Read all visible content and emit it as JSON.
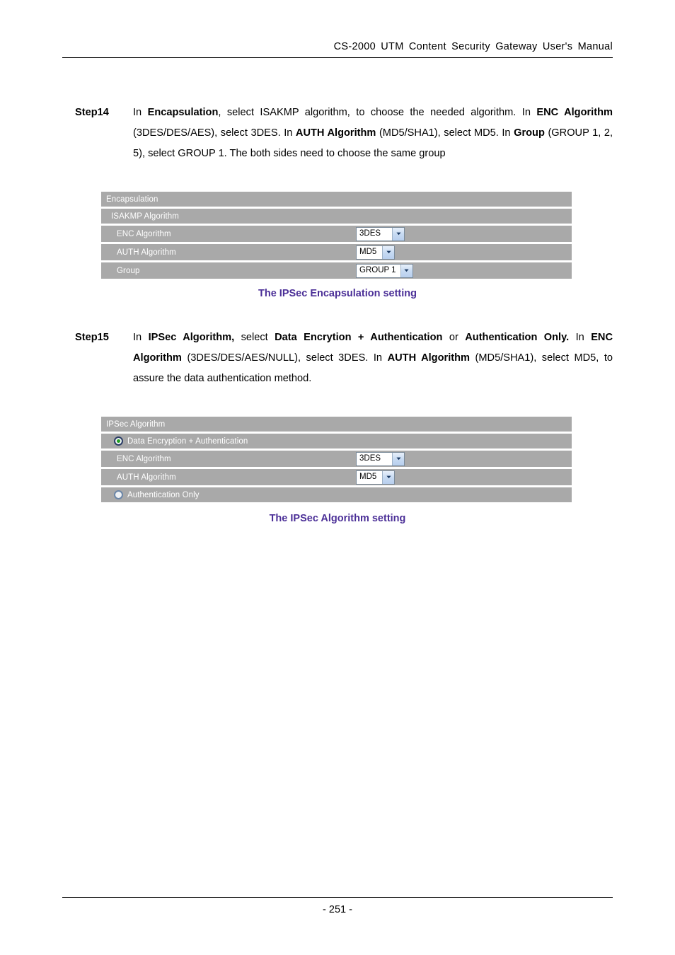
{
  "header": {
    "title": "CS-2000 UTM Content Security Gateway User's Manual"
  },
  "footer": {
    "page_number": "- 251 -"
  },
  "steps": [
    {
      "label": "Step14",
      "parts": [
        {
          "text": "In ",
          "bold": false
        },
        {
          "text": "Encapsulation",
          "bold": true
        },
        {
          "text": ", select ISAKMP algorithm, to choose the needed algorithm. In ",
          "bold": false
        },
        {
          "text": "ENC Algorithm",
          "bold": true
        },
        {
          "text": " (3DES/DES/AES), select 3DES. In ",
          "bold": false
        },
        {
          "text": "AUTH Algorithm",
          "bold": true
        },
        {
          "text": " (MD5/SHA1), select MD5. In ",
          "bold": false
        },
        {
          "text": "Group",
          "bold": true
        },
        {
          "text": " (GROUP 1, 2, 5), select GROUP 1. The both sides need to choose the same group",
          "bold": false
        }
      ]
    },
    {
      "label": "Step15",
      "parts": [
        {
          "text": "In ",
          "bold": false
        },
        {
          "text": "IPSec Algorithm,",
          "bold": true
        },
        {
          "text": " select ",
          "bold": false
        },
        {
          "text": "Data Encrytion + Authentication",
          "bold": true
        },
        {
          "text": " or ",
          "bold": false
        },
        {
          "text": "Authentication Only.",
          "bold": true
        },
        {
          "text": " In ",
          "bold": false
        },
        {
          "text": "ENC Algorithm",
          "bold": true
        },
        {
          "text": " (3DES/DES/AES/NULL), select 3DES. In ",
          "bold": false
        },
        {
          "text": "AUTH Algorithm",
          "bold": true
        },
        {
          "text": " (MD5/SHA1), select MD5, to assure the data authentication method.",
          "bold": false
        }
      ]
    }
  ],
  "panel_encapsulation": {
    "rows": [
      {
        "label": "Encapsulation",
        "indent": 0,
        "control": "none"
      },
      {
        "label": "ISAKMP Algorithm",
        "indent": 1,
        "control": "none"
      },
      {
        "label": "ENC Algorithm",
        "indent": 2,
        "control": "select",
        "value": "3DES"
      },
      {
        "label": "AUTH Algorithm",
        "indent": 2,
        "control": "select",
        "value": "MD5"
      },
      {
        "label": "Group",
        "indent": 2,
        "control": "select",
        "value": "GROUP 1"
      }
    ]
  },
  "panel_ipsec": {
    "rows": [
      {
        "label": "IPSec Algorithm",
        "indent": 0,
        "control": "none"
      },
      {
        "label": "Data Encryption + Authentication",
        "indent": 0,
        "control": "radio",
        "checked": true
      },
      {
        "label": "ENC Algorithm",
        "indent": 2,
        "control": "select",
        "value": "3DES"
      },
      {
        "label": "AUTH Algorithm",
        "indent": 2,
        "control": "select",
        "value": "MD5"
      },
      {
        "label": "Authentication Only",
        "indent": 0,
        "control": "radio",
        "checked": false
      }
    ]
  },
  "captions": {
    "figure1": "The IPSec Encapsulation setting",
    "figure2": "The IPSec Algorithm setting"
  },
  "colors": {
    "panel_row_bg": "#a9a9a9",
    "panel_label": "#ffffff",
    "caption": "#4b2f97",
    "radio_selected_dot": "#21a021",
    "radio_selected_ring": "#2c3e66",
    "radio_unselected_ring": "#6b86a8"
  },
  "icons": {
    "dropdown_arrow": "chevron-down-icon",
    "radio_selected": "radio-selected-icon",
    "radio_unselected": "radio-unselected-icon"
  }
}
